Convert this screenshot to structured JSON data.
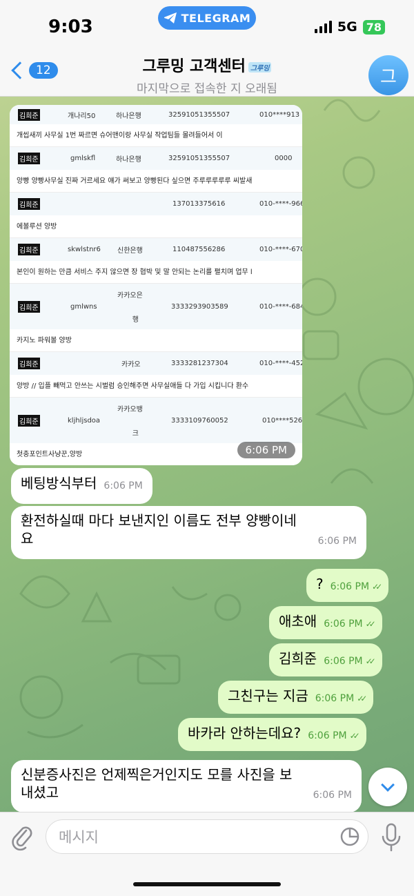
{
  "status": {
    "time": "9:03",
    "app_pill": "TELEGRAM",
    "network": "5G",
    "battery": "78"
  },
  "header": {
    "back_count": "12",
    "title": "그루밍 고객센터",
    "title_tag": "그루밍",
    "subtitle": "마지막으로 접속한 지 오래됨",
    "avatar_letter": "그"
  },
  "image_message": {
    "time": "6:06 PM",
    "rows": [
      {
        "name": "김희준",
        "id": "개나리50",
        "bank": "하나은행",
        "account": "32591051355507",
        "phone": "010****913"
      },
      {
        "note": "개씹새끼 사무실 1번 짜르면 슈어맨이랑 사무실 작업팀들 몰려들어서 이"
      },
      {
        "name": "김희준",
        "id": "gmlskfl",
        "bank": "하나은행",
        "account": "32591051355507",
        "phone": "0000"
      },
      {
        "note": "양빵 양빵사무실 진짜 거르세요 얘가 써보고 양빵된다 싶으면 주루루루루루 씨발새"
      },
      {
        "name": "김희준",
        "id": "",
        "bank": "",
        "account": "137013375616",
        "phone": "010-****-966"
      },
      {
        "note": "에볼루션 양방"
      },
      {
        "name": "김희준",
        "id": "skwlstnr6",
        "bank": "신한은행",
        "account": "110487556286",
        "phone": "010-****-670"
      },
      {
        "note": "본인이 원하는 만큼 서비스 주지 않으면 장 협박 및 말 안되는 논리를 펼치며 업무 l"
      },
      {
        "name": "김희준",
        "id": "gmlwns",
        "bank_a": "카카오은",
        "bank_b": "행",
        "account": "3333293903589",
        "phone": "010-****-684"
      },
      {
        "note": "카지노 파워볼 양방"
      },
      {
        "name": "김희준",
        "id": "",
        "bank": "카카오",
        "account": "3333281237304",
        "phone": "010-****-452"
      },
      {
        "note": "양방 // 입플 빼먹고 안쓰는 시벌럼 승인해주면 사무실애들 다 가입 시킵니다 환수"
      },
      {
        "name": "김희준",
        "id": "kljhljsdoa",
        "bank_a": "카카오뱅",
        "bank_b": "크",
        "account": "3333109760052",
        "phone": "010****526"
      },
      {
        "note": "첫충포인트사냥꾼,양방"
      }
    ]
  },
  "messages": [
    {
      "dir": "in",
      "text": "베팅방식부터",
      "time": "6:06 PM"
    },
    {
      "dir": "in",
      "text_l1": "환전하실때 마다 보낸지인 이름도 전부 양빵이네",
      "text_l2": "요",
      "time": "6:06 PM"
    },
    {
      "dir": "out",
      "text": "?",
      "time": "6:06 PM"
    },
    {
      "dir": "out",
      "text": "애초애",
      "time": "6:06 PM"
    },
    {
      "dir": "out",
      "text": "김희준",
      "time": "6:06 PM"
    },
    {
      "dir": "out",
      "text": "그친구는 지금",
      "time": "6:06 PM"
    },
    {
      "dir": "out",
      "text": "바카라 안하는데요?",
      "time": "6:06 PM"
    },
    {
      "dir": "in",
      "text_l1": "신분증사진은 언제찍은거인지도 모를 사진을 보",
      "text_l2": "내셨고",
      "time": "6:06 PM"
    }
  ],
  "input": {
    "placeholder": "메시지"
  },
  "colors": {
    "accent": "#2f8ceb",
    "out_bubble": "#e2fbc8",
    "in_bubble": "#ffffff",
    "battery": "#35c759"
  },
  "icons": [
    "telegram-icon",
    "signal-icon",
    "back-chevron-icon",
    "attach-icon",
    "sticker-icon",
    "mic-icon",
    "scroll-down-icon",
    "read-check-icon"
  ]
}
